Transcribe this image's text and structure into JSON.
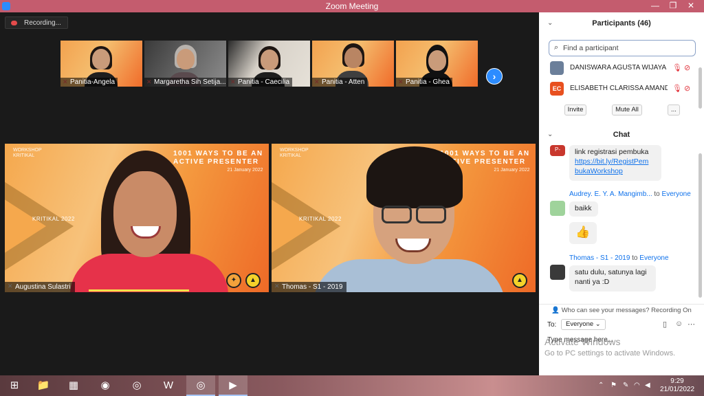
{
  "window": {
    "title": "Zoom Meeting",
    "controls": [
      "—",
      "❐",
      "✕"
    ]
  },
  "recording": {
    "label": "Recording..."
  },
  "thumbnails": [
    {
      "name": "Panitia-Angela"
    },
    {
      "name": "Margaretha Sih Setija..."
    },
    {
      "name": "Panitia - Caecilia"
    },
    {
      "name": "Panitia - Atten"
    },
    {
      "name": "Panitia - Ghea"
    }
  ],
  "tiles": [
    {
      "name": "Augustina Sulastri",
      "banner_line1": "1001 WAYS TO BE AN",
      "banner_line2": "ACTIVE PRESENTER",
      "banner_date": "21 January 2022",
      "brand_line1": "WORKSHOP",
      "brand_line2": "KRITIKAL",
      "event": "KRITIKAL 2022"
    },
    {
      "name": "Thomas - S1 - 2019",
      "banner_line1": "1001 WAYS TO BE AN",
      "banner_line2": "ACTIVE PRESENTER",
      "banner_date": "21 January 2022",
      "brand_line1": "WORKSHOP",
      "brand_line2": "KRITIKAL",
      "event": "KRITIKAL 2022"
    }
  ],
  "participants": {
    "title": "Participants (46)",
    "search_placeholder": "Find a participant",
    "list": [
      {
        "name": "DANISWARA AGUSTA WIJAYA",
        "avatar": "",
        "avatar_color": "#6b7f9a"
      },
      {
        "name": "ELISABETH CLARISSA AMANDA...",
        "avatar": "EC",
        "avatar_color": "#e8501f"
      }
    ],
    "buttons": {
      "invite": "Invite",
      "mute_all": "Mute All",
      "more": "..."
    }
  },
  "chat": {
    "title": "Chat",
    "messages": [
      {
        "avatar": "P-",
        "avatar_color": "#c8372d",
        "text": "link registrasi pembuka",
        "link": "https://bit.ly/RegistPembukaWorkshop",
        "link_line1": "https://bit.ly/RegistPem",
        "link_line2": "bukaWorkshop"
      },
      {
        "sender": "Audrey. E. Y. A. Mangimb...",
        "to_label": "to",
        "to": "Everyone",
        "avatar_color": "#9fd39b",
        "text": "baikk",
        "emoji": "👍"
      },
      {
        "sender": "Thomas - S1 - 2019",
        "to_label": "to",
        "to": "Everyone",
        "avatar_color": "#3a3a3a",
        "line1": "satu dulu, satunya lagi",
        "line2": "nanti ya :D"
      }
    ],
    "visibility_note": "Who can see your messages? Recording On",
    "to_label": "To:",
    "to_value": "Everyone",
    "input_placeholder": "Type message here..."
  },
  "watermark": {
    "line1": "Activate Windows",
    "line2": "Go to PC settings to activate Windows."
  },
  "taskbar": {
    "time": "9:29",
    "date": "21/01/2022"
  },
  "colors": {
    "zoom_blue": "#2d8cff",
    "titlebar": "#c45c6e",
    "link": "#0e71eb",
    "muted_red": "#e2373f"
  }
}
